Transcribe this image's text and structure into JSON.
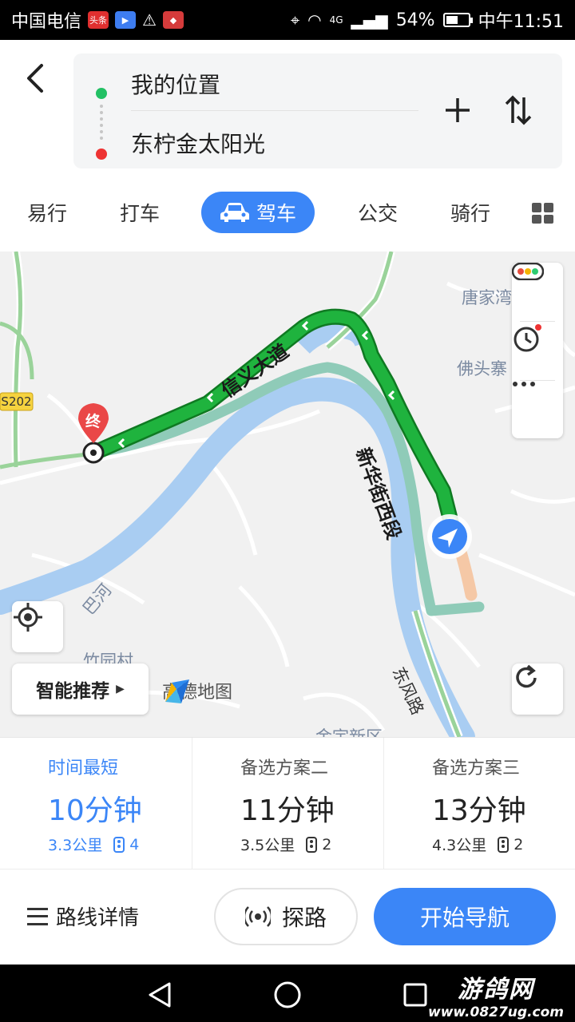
{
  "status_bar": {
    "carrier": "中国电信",
    "app_badges": [
      "头条",
      "",
      "",
      ""
    ],
    "network": "4G",
    "battery_percent": "54%",
    "battery_level": 0.54,
    "time": "中午11:51"
  },
  "search": {
    "origin": "我的位置",
    "destination": "东柠金太阳光"
  },
  "modes": {
    "walk": "易行",
    "taxi": "打车",
    "drive": "驾车",
    "bus": "公交",
    "ride": "骑行"
  },
  "map": {
    "end_marker": "终",
    "road_label_a": "信义大道",
    "road_label_b": "新华街西段",
    "road_label_c": "东风路",
    "place_1": "唐家湾",
    "place_2": "佛头寨",
    "place_3": "竹园村",
    "place_4": "金宇新区",
    "river": "巴河",
    "highway": "S202",
    "recommend": "智能推荐",
    "brand": "高德地图"
  },
  "routes": [
    {
      "title": "时间最短",
      "time": "10分钟",
      "distance": "3.3公里",
      "lights": "4"
    },
    {
      "title": "备选方案二",
      "time": "11分钟",
      "distance": "3.5公里",
      "lights": "2"
    },
    {
      "title": "备选方案三",
      "time": "13分钟",
      "distance": "4.3公里",
      "lights": "2"
    }
  ],
  "actions": {
    "details": "路线详情",
    "probe": "探路",
    "start": "开始导航"
  },
  "watermark": {
    "title": "游鸽网",
    "url": "www.0827ug.com"
  },
  "colors": {
    "accent": "#3b86f7",
    "route_main": "#1fb33e",
    "route_alt": "#8fcbb8",
    "origin_dot": "#22c064",
    "dest_dot": "#ee3333",
    "river": "#a9cdf2"
  }
}
